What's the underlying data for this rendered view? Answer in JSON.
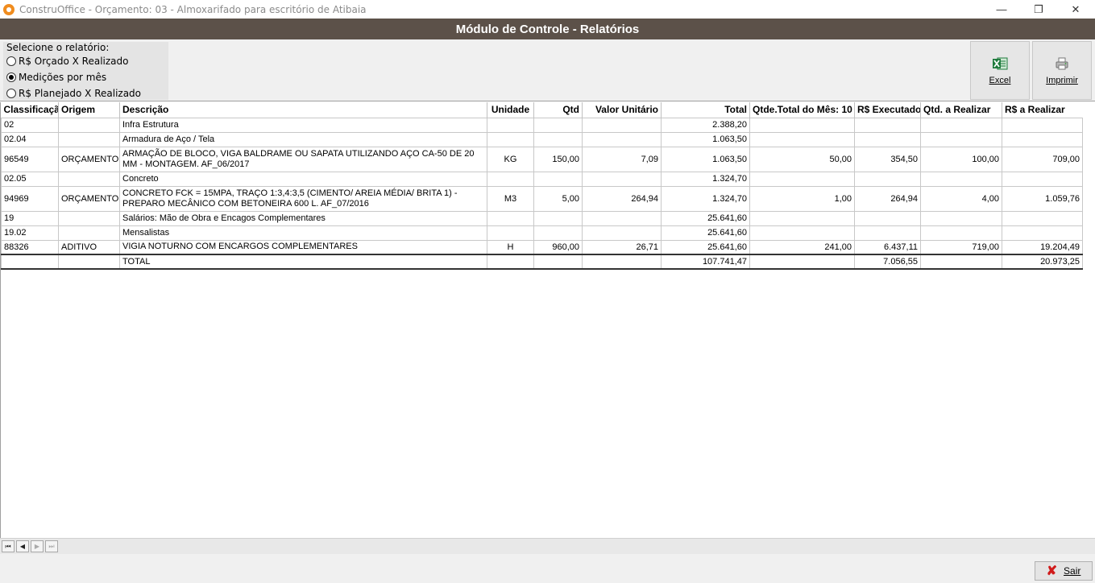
{
  "window": {
    "title": "ConstruOffice - Orçamento: 03 - Almoxarifado para escritório de Atibaia",
    "minimize": "—",
    "maximize": "❐",
    "close": "✕"
  },
  "header": {
    "title": "Módulo de Controle - Relatórios"
  },
  "report_selector": {
    "label": "Selecione o relatório:",
    "options": [
      {
        "label": "R$  Orçado X Realizado",
        "checked": false
      },
      {
        "label": "Medições por mês",
        "checked": true
      },
      {
        "label": "R$  Planejado X Realizado",
        "checked": false
      }
    ]
  },
  "toolbar": {
    "excel_label": "Excel",
    "print_label": "Imprimir"
  },
  "grid": {
    "columns": [
      "Classificação",
      "Origem",
      "Descrição",
      "Unidade",
      "Qtd",
      "Valor Unitário",
      "Total",
      "Qtde.Total do Mês: 10",
      "R$ Executado",
      "Qtd. a Realizar",
      "R$ a Realizar"
    ],
    "rows": [
      [
        "02",
        "",
        "Infra Estrutura",
        "",
        "",
        "",
        "2.388,20",
        "",
        "",
        "",
        ""
      ],
      [
        "02.04",
        "",
        "Armadura de Aço / Tela",
        "",
        "",
        "",
        "1.063,50",
        "",
        "",
        "",
        ""
      ],
      [
        "96549",
        "ORÇAMENTO",
        "ARMAÇÃO DE BLOCO, VIGA BALDRAME OU SAPATA UTILIZANDO AÇO CA-50 DE 20 MM - MONTAGEM. AF_06/2017",
        "KG",
        "150,00",
        "7,09",
        "1.063,50",
        "50,00",
        "354,50",
        "100,00",
        "709,00"
      ],
      [
        "02.05",
        "",
        "Concreto",
        "",
        "",
        "",
        "1.324,70",
        "",
        "",
        "",
        ""
      ],
      [
        "94969",
        "ORÇAMENTO",
        "CONCRETO FCK = 15MPA, TRAÇO 1:3,4:3,5 (CIMENTO/ AREIA MÉDIA/ BRITA 1)  - PREPARO MECÂNICO COM BETONEIRA 600 L. AF_07/2016",
        "M3",
        "5,00",
        "264,94",
        "1.324,70",
        "1,00",
        "264,94",
        "4,00",
        "1.059,76"
      ],
      [
        "19",
        "",
        "Salários: Mão de Obra e Encagos Complementares",
        "",
        "",
        "",
        "25.641,60",
        "",
        "",
        "",
        ""
      ],
      [
        "19.02",
        "",
        "Mensalistas",
        "",
        "",
        "",
        "25.641,60",
        "",
        "",
        "",
        ""
      ],
      [
        "88326",
        "ADITIVO",
        "VIGIA NOTURNO COM ENCARGOS COMPLEMENTARES",
        "H",
        "960,00",
        "26,71",
        "25.641,60",
        "241,00",
        "6.437,11",
        "719,00",
        "19.204,49"
      ]
    ],
    "total_row": [
      "",
      "",
      "TOTAL",
      "",
      "",
      "",
      "107.741,47",
      "",
      "7.056,55",
      "",
      "20.973,25"
    ]
  },
  "navigator": {
    "first": "⏮",
    "prev": "◀",
    "next": "▶",
    "last": "⏭"
  },
  "footer": {
    "exit_label": "Sair",
    "exit_icon": "✘"
  },
  "colors": {
    "header_band": "#5c5149",
    "app_icon": "#f08c1e",
    "excel_green": "#1e7a3c",
    "exit_red": "#d01a1a"
  }
}
